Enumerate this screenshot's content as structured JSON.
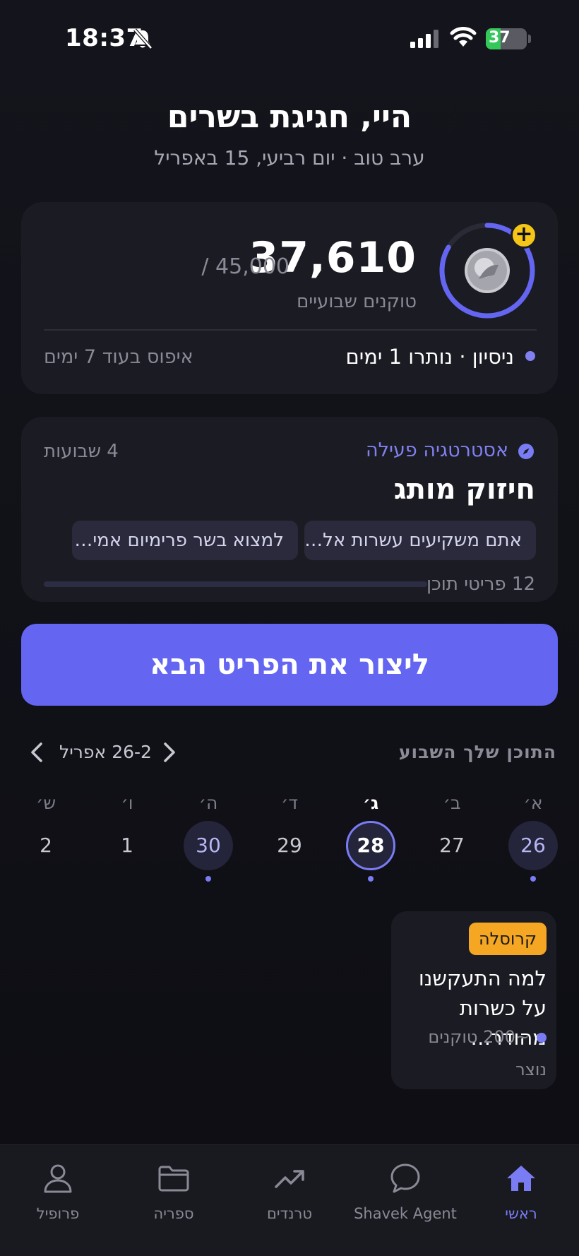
{
  "status_bar": {
    "time": "18:37",
    "battery": "37",
    "battery_level": 0.37
  },
  "header": {
    "greeting": "היי, חגיגת בשרים",
    "subtitle": "ערב טוב · יום רביעי, 15 באפריל"
  },
  "tokens": {
    "value": "37,610",
    "max": "/ 45,000",
    "label": "טוקנים שבועיים",
    "trial": "ניסיון · נותרו 1 ימים",
    "reset": "איפוס בעוד 7 ימים",
    "usage_fraction": 0.836
  },
  "strategy": {
    "tag": "אסטרטגיה פעילה",
    "weeks": "4 שבועות",
    "title": "חיזוק מותג",
    "chips": [
      "אתם משקיעים עשרות אל…",
      "למצוא בשר פרימיום אמי…"
    ],
    "items_label": "12 פריטי תוכן"
  },
  "cta": {
    "label": "ליצור את הפריט הבא"
  },
  "week": {
    "title": "התוכן שלך השבוע",
    "range": "26-2 אפריל",
    "days": [
      {
        "letter": "א׳",
        "num": "26",
        "has_content": true,
        "today": false
      },
      {
        "letter": "ב׳",
        "num": "27",
        "has_content": false,
        "today": false
      },
      {
        "letter": "ג׳",
        "num": "28",
        "has_content": true,
        "today": true
      },
      {
        "letter": "ד׳",
        "num": "29",
        "has_content": false,
        "today": false
      },
      {
        "letter": "ה׳",
        "num": "30",
        "has_content": true,
        "today": false
      },
      {
        "letter": "ו׳",
        "num": "1",
        "has_content": false,
        "today": false
      },
      {
        "letter": "ש׳",
        "num": "2",
        "has_content": false,
        "today": false
      }
    ]
  },
  "content_card": {
    "badge": "קרוסלה",
    "title": "למה התעקשנו על כשרות מהודר…",
    "tokens": "~200 טוקנים",
    "status": "נוצר"
  },
  "tabs": [
    {
      "label": "ראשי",
      "icon": "home-icon",
      "active": true
    },
    {
      "label": "Shavek Agent",
      "icon": "chat-bubble-icon",
      "active": false
    },
    {
      "label": "טרנדים",
      "icon": "trending-icon",
      "active": false
    },
    {
      "label": "ספריה",
      "icon": "folder-icon",
      "active": false
    },
    {
      "label": "פרופיל",
      "icon": "user-icon",
      "active": false
    }
  ],
  "colors": {
    "accent": "#6466f1",
    "background": "#121219",
    "card": "#1b1b23",
    "badge": "#f5a623",
    "plus": "#f5c518"
  }
}
